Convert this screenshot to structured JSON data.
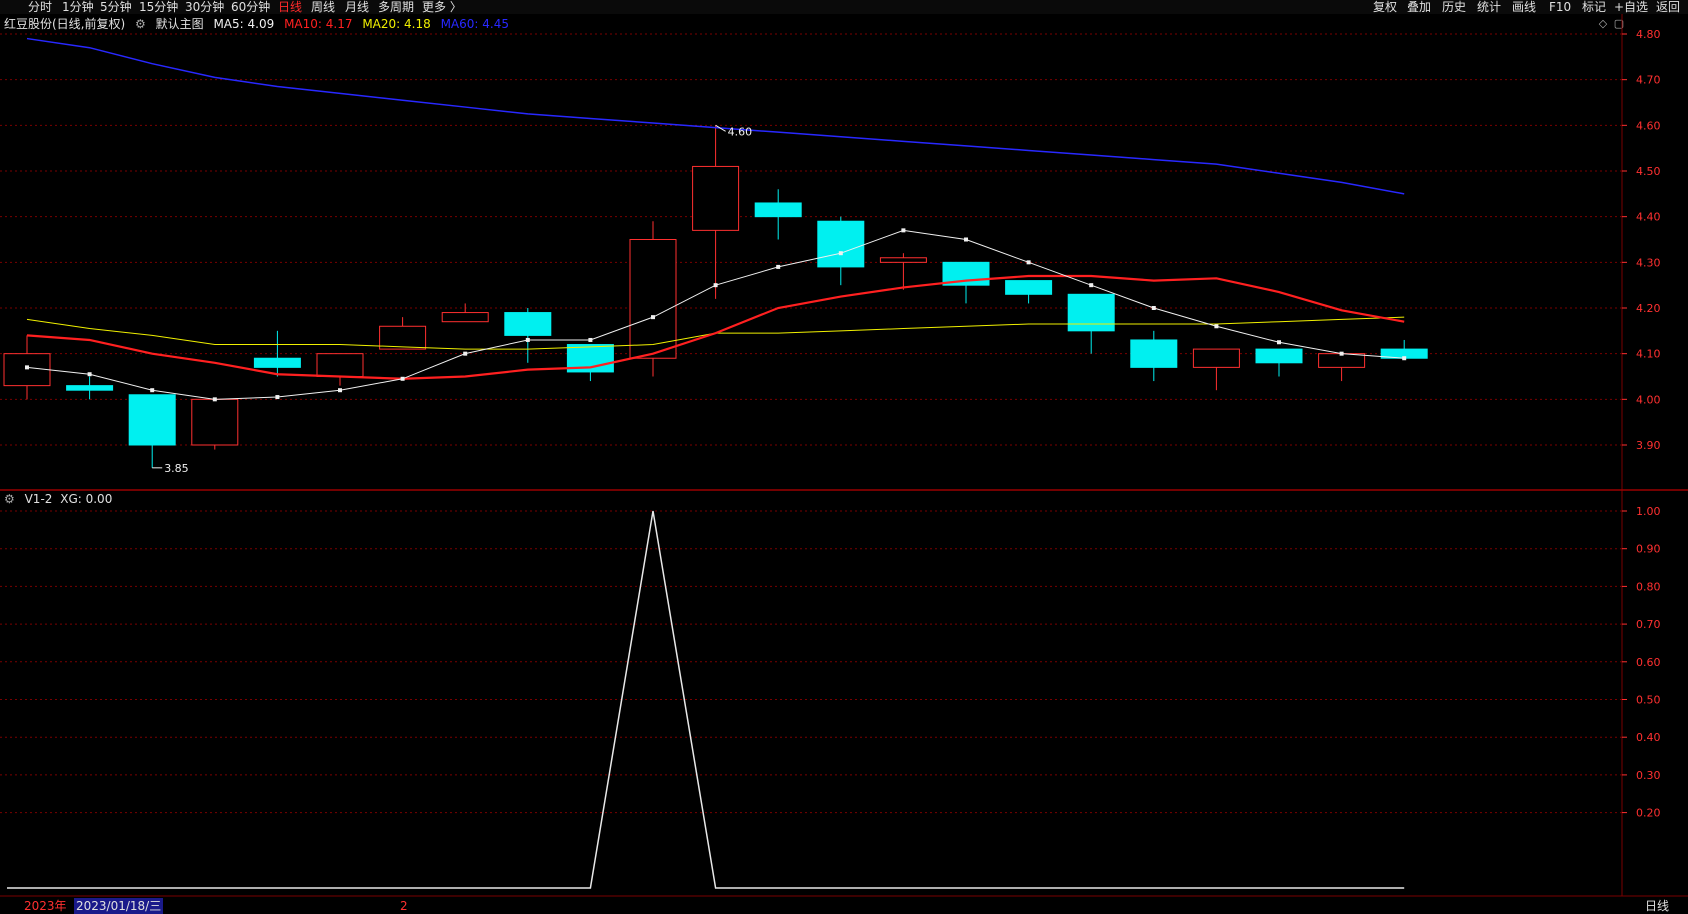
{
  "toolbar": {
    "periods": [
      "分时",
      "1分钟",
      "5分钟",
      "15分钟",
      "30分钟",
      "60分钟",
      "日线",
      "周线",
      "月线",
      "多周期",
      "更多 〉"
    ],
    "active": "日线",
    "actions": [
      "复权",
      "叠加",
      "历史",
      "统计",
      "画线",
      "F10",
      "标记",
      "+自选",
      "返回"
    ]
  },
  "main_info": {
    "stock_label": "红豆股份(日线,前复权)",
    "chart_name": "默认主图",
    "ma5": "MA5: 4.09",
    "ma10": "MA10: 4.17",
    "ma20": "MA20: 4.18",
    "ma60": "MA60: 4.45"
  },
  "sub_info": {
    "label": "V1-2",
    "xg": "XG: 0.00"
  },
  "colors": {
    "up": "#ff3030",
    "down": "#00f0f0",
    "ma5": "#f0f0f0",
    "ma10": "#ff2020",
    "ma20": "#f0f000",
    "ma60": "#2828ff",
    "grid": "#7a0000",
    "axis_text": "#ff3030"
  },
  "annotations": {
    "high": "4.60",
    "low": "3.85"
  },
  "bottom_bar": {
    "year": "2023年",
    "date": "2023/01/18/三",
    "mark": "2",
    "period": "日线"
  },
  "chart_data": [
    {
      "type": "candlestick",
      "y_axis": {
        "labels": [
          "4.80",
          "4.70",
          "4.60",
          "4.50",
          "4.40",
          "4.30",
          "4.20",
          "4.10",
          "4.00",
          "3.90"
        ],
        "range": [
          3.82,
          4.84
        ]
      },
      "candles": [
        {
          "o": 4.03,
          "c": 4.1,
          "h": 4.14,
          "l": 4.0
        },
        {
          "o": 4.03,
          "c": 4.02,
          "h": 4.05,
          "l": 4.0
        },
        {
          "o": 4.01,
          "c": 3.9,
          "h": 4.01,
          "l": 3.85
        },
        {
          "o": 3.9,
          "c": 4.0,
          "h": 4.0,
          "l": 3.89
        },
        {
          "o": 4.09,
          "c": 4.07,
          "h": 4.15,
          "l": 4.05
        },
        {
          "o": 4.05,
          "c": 4.1,
          "h": 4.1,
          "l": 4.03
        },
        {
          "o": 4.11,
          "c": 4.16,
          "h": 4.18,
          "l": 4.11
        },
        {
          "o": 4.17,
          "c": 4.19,
          "h": 4.21,
          "l": 4.17
        },
        {
          "o": 4.19,
          "c": 4.14,
          "h": 4.2,
          "l": 4.08
        },
        {
          "o": 4.12,
          "c": 4.06,
          "h": 4.12,
          "l": 4.04
        },
        {
          "o": 4.09,
          "c": 4.35,
          "h": 4.39,
          "l": 4.05
        },
        {
          "o": 4.37,
          "c": 4.51,
          "h": 4.6,
          "l": 4.22
        },
        {
          "o": 4.43,
          "c": 4.4,
          "h": 4.46,
          "l": 4.35
        },
        {
          "o": 4.39,
          "c": 4.29,
          "h": 4.4,
          "l": 4.25
        },
        {
          "o": 4.3,
          "c": 4.31,
          "h": 4.32,
          "l": 4.24
        },
        {
          "o": 4.3,
          "c": 4.25,
          "h": 4.3,
          "l": 4.21
        },
        {
          "o": 4.26,
          "c": 4.23,
          "h": 4.26,
          "l": 4.21
        },
        {
          "o": 4.23,
          "c": 4.15,
          "h": 4.23,
          "l": 4.1
        },
        {
          "o": 4.13,
          "c": 4.07,
          "h": 4.15,
          "l": 4.04
        },
        {
          "o": 4.07,
          "c": 4.11,
          "h": 4.11,
          "l": 4.02
        },
        {
          "o": 4.11,
          "c": 4.08,
          "h": 4.11,
          "l": 4.05
        },
        {
          "o": 4.07,
          "c": 4.1,
          "h": 4.1,
          "l": 4.04
        },
        {
          "o": 4.11,
          "c": 4.09,
          "h": 4.13,
          "l": 4.09
        }
      ],
      "ma5": [
        4.07,
        4.055,
        4.02,
        4.0,
        4.005,
        4.02,
        4.045,
        4.1,
        4.13,
        4.13,
        4.18,
        4.25,
        4.29,
        4.32,
        4.37,
        4.35,
        4.3,
        4.25,
        4.2,
        4.16,
        4.125,
        4.1,
        4.09
      ],
      "ma10": [
        4.14,
        4.13,
        4.1,
        4.08,
        4.055,
        4.05,
        4.045,
        4.05,
        4.065,
        4.07,
        4.1,
        4.145,
        4.2,
        4.225,
        4.245,
        4.26,
        4.27,
        4.27,
        4.26,
        4.265,
        4.235,
        4.195,
        4.17
      ],
      "ma20": [
        4.175,
        4.155,
        4.14,
        4.12,
        4.12,
        4.12,
        4.115,
        4.11,
        4.11,
        4.115,
        4.12,
        4.145,
        4.145,
        4.15,
        4.155,
        4.16,
        4.165,
        4.165,
        4.165,
        4.165,
        4.17,
        4.175,
        4.18
      ],
      "ma60": [
        4.79,
        4.77,
        4.735,
        4.705,
        4.685,
        4.67,
        4.655,
        4.64,
        4.625,
        4.615,
        4.605,
        4.595,
        4.585,
        4.575,
        4.565,
        4.555,
        4.545,
        4.535,
        4.525,
        4.515,
        4.495,
        4.475,
        4.45
      ]
    },
    {
      "type": "line",
      "title": "V1-2",
      "y_axis": {
        "labels": [
          "1.00",
          "0.90",
          "0.80",
          "0.70",
          "0.60",
          "0.50",
          "0.40",
          "0.30",
          "0.20"
        ],
        "range": [
          0,
          1.0
        ]
      },
      "values": [
        0,
        0,
        0,
        0,
        0,
        0,
        0,
        0,
        0,
        0,
        1,
        0,
        0,
        0,
        0,
        0,
        0,
        0,
        0,
        0,
        0,
        0,
        0
      ]
    }
  ]
}
